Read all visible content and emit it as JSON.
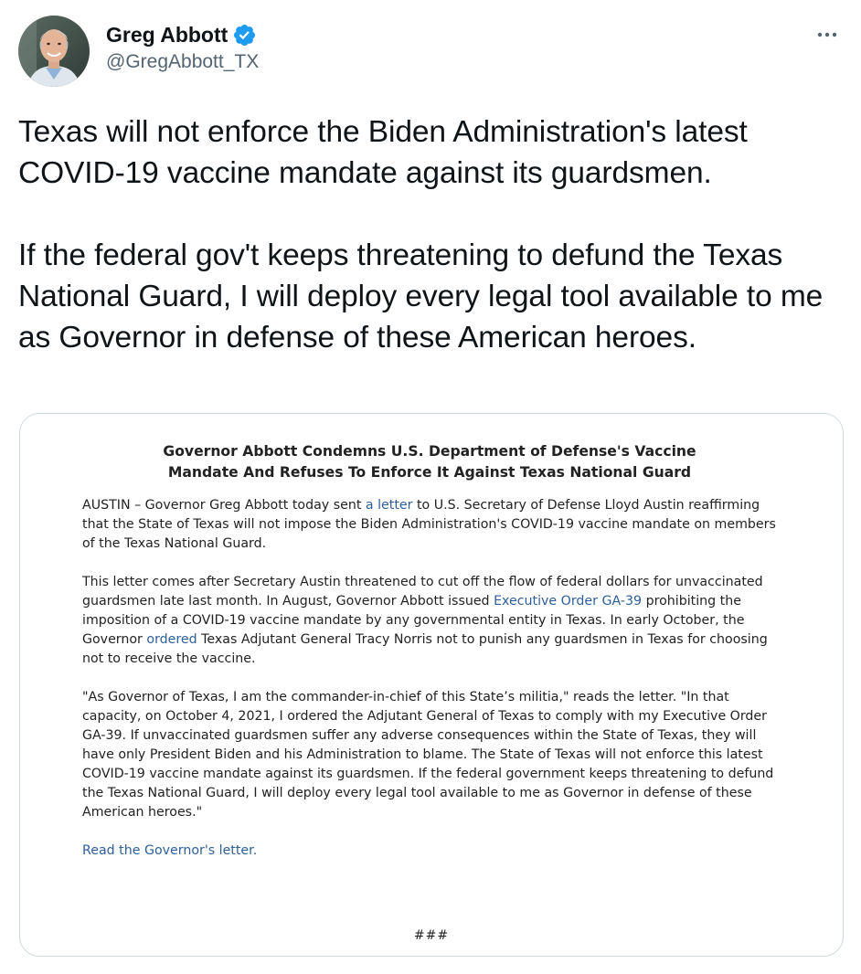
{
  "author": {
    "display_name": "Greg Abbott",
    "handle": "@GregAbbott_TX",
    "verified": true,
    "verified_icon": "verified-badge-icon",
    "verified_color": "#1d9bf0",
    "avatar_icon": "profile-photo"
  },
  "more_icon": "more-horizontal-icon",
  "tweet": {
    "paragraph_1": "Texas will not enforce the Biden Administration's latest COVID-19 vaccine mandate against its guardsmen.",
    "paragraph_2": "If the federal gov't keeps threatening to defund the Texas National Guard, I will deploy every legal tool available to me as Governor in defense of these American heroes."
  },
  "press_release": {
    "title_line_1": "Governor Abbott Condemns U.S. Department of Defense's Vaccine",
    "title_line_2": "Mandate And Refuses To Enforce It Against Texas National Guard",
    "p1": {
      "before_link": "AUSTIN – Governor Greg Abbott today sent ",
      "link": "a letter",
      "after_link": " to U.S. Secretary of Defense Lloyd Austin reaffirming that the State of Texas will not impose the Biden Administration's COVID-19 vaccine mandate on members of the Texas National Guard."
    },
    "p2": {
      "part_1": "This letter comes after Secretary Austin threatened to cut off the flow of federal dollars for unvaccinated guardsmen late last month. In August, Governor Abbott issued ",
      "link_1": "Executive Order GA-39",
      "part_2": " prohibiting the imposition of a COVID-19 vaccine mandate by any governmental entity in Texas. In early October, the Governor ",
      "link_2": "ordered",
      "part_3": " Texas Adjutant General Tracy Norris not to punish any guardsmen in Texas for choosing not to receive the vaccine."
    },
    "p3": "\"As Governor of Texas, I am the commander-in-chief of this State’s militia,\" reads the letter. \"In that capacity, on October 4, 2021, I ordered the Adjutant General of Texas to comply with my Executive Order GA-39. If unvaccinated guardsmen suffer any adverse consequences within the State of Texas, they will have only President Biden and his Administration to blame. The State of Texas will not enforce this latest COVID-19 vaccine mandate against its guardsmen. If the federal government keeps threatening to defund the Texas National Guard, I will deploy every legal tool available to me as Governor in defense of these American heroes.\"",
    "read_link": "Read the Governor's letter.",
    "end_marker": "###"
  },
  "colors": {
    "text_primary": "#0f1419",
    "text_secondary": "#536471",
    "link_blue": "#2d5f9a",
    "card_border": "#cfd9de"
  }
}
